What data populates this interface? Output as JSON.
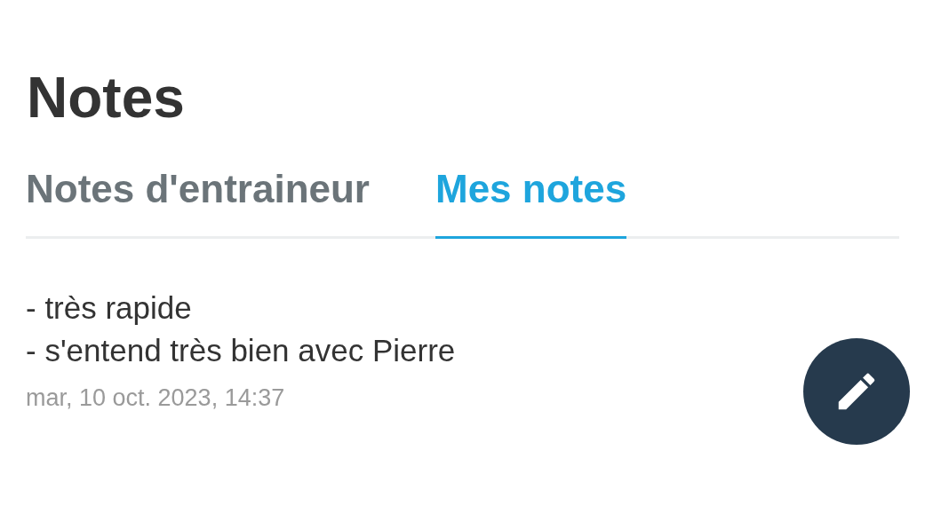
{
  "title": "Notes",
  "tabs": [
    {
      "label": "Notes d'entraineur",
      "selected": false
    },
    {
      "label": "Mes notes",
      "selected": true
    }
  ],
  "note": {
    "lines": [
      "- très rapide",
      "- s'entend très bien avec Pierre"
    ],
    "date": "mar, 10 oct. 2023, 14:37"
  }
}
